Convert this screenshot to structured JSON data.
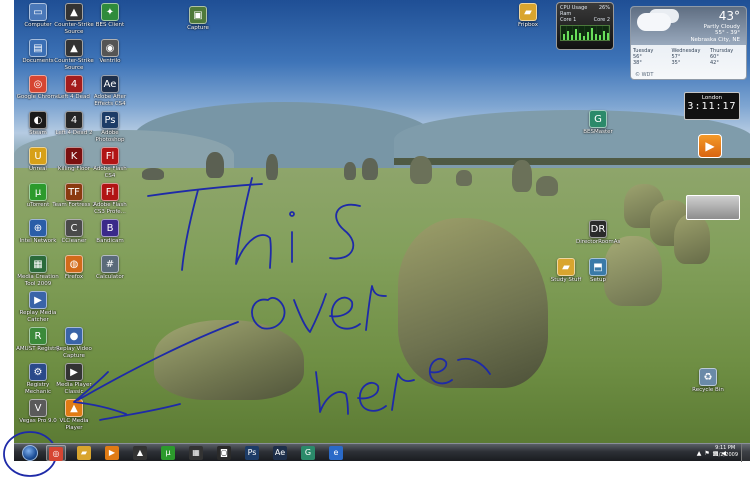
{
  "desktop_icons": [
    {
      "label": "Computer",
      "icon": "computer-icon",
      "color": "#4a78b8",
      "glyph": "▭"
    },
    {
      "label": "Counter-Strike Source",
      "icon": "game-icon",
      "color": "#333333",
      "glyph": "▲"
    },
    {
      "label": "BES Client",
      "icon": "bes-icon",
      "color": "#2f8b3b",
      "glyph": "✦"
    },
    {
      "label": "Documents",
      "icon": "documents-icon",
      "color": "#3b6fb4",
      "glyph": "▤"
    },
    {
      "label": "Counter-Strike Source",
      "icon": "game-icon",
      "color": "#333333",
      "glyph": "▲"
    },
    {
      "label": "Ventrilo",
      "icon": "ventrilo-icon",
      "color": "#555555",
      "glyph": "◉"
    },
    {
      "label": "Google Chrome",
      "icon": "chrome-icon",
      "color": "#d64532",
      "glyph": "◎"
    },
    {
      "label": "Left 4 Dead",
      "icon": "l4d-icon",
      "color": "#a31c1c",
      "glyph": "4"
    },
    {
      "label": "Adobe After Effects CS4",
      "icon": "after-effects-icon",
      "color": "#1e2f4a",
      "glyph": "Ae"
    },
    {
      "label": "Steam",
      "icon": "steam-icon",
      "color": "#1a1a1a",
      "glyph": "◐"
    },
    {
      "label": "Left 4 Dead 2",
      "icon": "l4d2-icon",
      "color": "#262626",
      "glyph": "4"
    },
    {
      "label": "Adobe Photoshop",
      "icon": "photoshop-icon",
      "color": "#1d3c67",
      "glyph": "Ps"
    },
    {
      "label": "Unreal",
      "icon": "unreal-icon",
      "color": "#d7a018",
      "glyph": "U"
    },
    {
      "label": "Killing Floor",
      "icon": "killing-floor-icon",
      "color": "#7a1010",
      "glyph": "K"
    },
    {
      "label": "Adobe Flash CS4",
      "icon": "flash-icon",
      "color": "#b11414",
      "glyph": "Fl"
    },
    {
      "label": "uTorrent",
      "icon": "utorrent-icon",
      "color": "#2c9a2c",
      "glyph": "µ"
    },
    {
      "label": "Team Fortress 2",
      "icon": "tf2-icon",
      "color": "#8a3a10",
      "glyph": "TF"
    },
    {
      "label": "Adobe Flash CS3 Profe...",
      "icon": "flash-icon",
      "color": "#b11414",
      "glyph": "Fl"
    },
    {
      "label": "Intel Network",
      "icon": "network-icon",
      "color": "#2a5ea8",
      "glyph": "⊕"
    },
    {
      "label": "CCleaner",
      "icon": "ccleaner-icon",
      "color": "#4a4a4a",
      "glyph": "C"
    },
    {
      "label": "Bandicam",
      "icon": "bandicam-icon",
      "color": "#3a2a8a",
      "glyph": "B"
    },
    {
      "label": "Media Creation Tool 2009",
      "icon": "media-tool-icon",
      "color": "#2a6a3a",
      "glyph": "▦"
    },
    {
      "label": "Firefox",
      "icon": "firefox-icon",
      "color": "#d26a1a",
      "glyph": "◍"
    },
    {
      "label": "Calculator",
      "icon": "calculator-icon",
      "color": "#5a6a7a",
      "glyph": "#"
    },
    {
      "label": "Replay Media Catcher",
      "icon": "replay-icon",
      "color": "#3a64a8",
      "glyph": "▶"
    },
    {
      "label": "AMUST Registry",
      "icon": "registry-icon",
      "color": "#3a8a3a",
      "glyph": "R"
    },
    {
      "label": "Replay Video Capture",
      "icon": "video-capture-icon",
      "color": "#3a64a8",
      "glyph": "●"
    },
    {
      "label": "Registry Mechanic",
      "icon": "registry-mechanic-icon",
      "color": "#2a4a8a",
      "glyph": "⚙"
    },
    {
      "label": "Media Player Classic",
      "icon": "mpc-icon",
      "color": "#333333",
      "glyph": "▶"
    },
    {
      "label": "Vegas Pro 9.0",
      "icon": "vegas-icon",
      "color": "#5a5a5a",
      "glyph": "V"
    },
    {
      "label": "VLC Media Player",
      "icon": "vlc-icon",
      "color": "#e07b14",
      "glyph": "▲"
    }
  ],
  "right_icons": [
    {
      "label": "Capture",
      "icon": "capture-icon",
      "color": "#4f7a3a",
      "glyph": "▣"
    },
    {
      "label": "Fripbox",
      "icon": "folder-icon",
      "color": "#d9a52e",
      "glyph": "▰"
    },
    {
      "label": "BESMaster",
      "icon": "bes-master-icon",
      "color": "#2b8a6a",
      "glyph": "G"
    },
    {
      "label": "DirectorRoomAssets",
      "icon": "director-icon",
      "color": "#2a2a2a",
      "glyph": "DR"
    },
    {
      "label": "Study Stuff",
      "icon": "folder-icon",
      "color": "#d9a52e",
      "glyph": "▰"
    },
    {
      "label": "Setup",
      "icon": "setup-icon",
      "color": "#3a7aa8",
      "glyph": "⬒"
    },
    {
      "label": "Recycle Bin",
      "icon": "recycle-bin-icon",
      "color": "#6a8aa8",
      "glyph": "♻"
    }
  ],
  "cpu_gadget": {
    "title": "CPU Usage",
    "percent": "26%",
    "core1": "Core 1",
    "core2": "Core 2",
    "ram": "Ram"
  },
  "weather_gadget": {
    "temp": "43°",
    "condition": "Partly Cloudy",
    "range": "55° - 39°",
    "city": "Nebraska City, NE",
    "days": [
      {
        "name": "Tuesday",
        "hi": "56°",
        "lo": "38°"
      },
      {
        "name": "Wednesday",
        "hi": "57°",
        "lo": "35°"
      },
      {
        "name": "Thursday",
        "hi": "60°",
        "lo": "42°"
      }
    ],
    "source": "© WDT"
  },
  "clock_gadget": {
    "city": "London",
    "time": "3:11:17"
  },
  "annotation": {
    "text": "This over here",
    "color": "#1e2aa8"
  },
  "taskbar": {
    "apps": [
      {
        "name": "chrome",
        "icon": "chrome-icon",
        "glyph": "◎",
        "color": "#d64532"
      },
      {
        "name": "explorer",
        "icon": "folder-icon",
        "glyph": "▰",
        "color": "#d9a52e"
      },
      {
        "name": "media-player",
        "icon": "media-player-icon",
        "glyph": "▶",
        "color": "#e07b14"
      },
      {
        "name": "counter-strike",
        "icon": "game-icon",
        "glyph": "▲",
        "color": "#333333"
      },
      {
        "name": "utorrent",
        "icon": "utorrent-icon",
        "glyph": "µ",
        "color": "#2c9a2c"
      },
      {
        "name": "movie-maker",
        "icon": "film-icon",
        "glyph": "▦",
        "color": "#333333"
      },
      {
        "name": "xbox",
        "icon": "controller-icon",
        "glyph": "◙",
        "color": "#2a2a2a"
      },
      {
        "name": "photoshop",
        "icon": "photoshop-icon",
        "glyph": "Ps",
        "color": "#1d3c67"
      },
      {
        "name": "after-effects",
        "icon": "after-effects-icon",
        "glyph": "Ae",
        "color": "#1e2f4a"
      },
      {
        "name": "bes",
        "icon": "bes-master-icon",
        "glyph": "G",
        "color": "#2b8a6a"
      },
      {
        "name": "ie",
        "icon": "browser-icon",
        "glyph": "e",
        "color": "#2a6ac8"
      }
    ],
    "time": "9:11 PM",
    "date": "11/2/2009"
  }
}
